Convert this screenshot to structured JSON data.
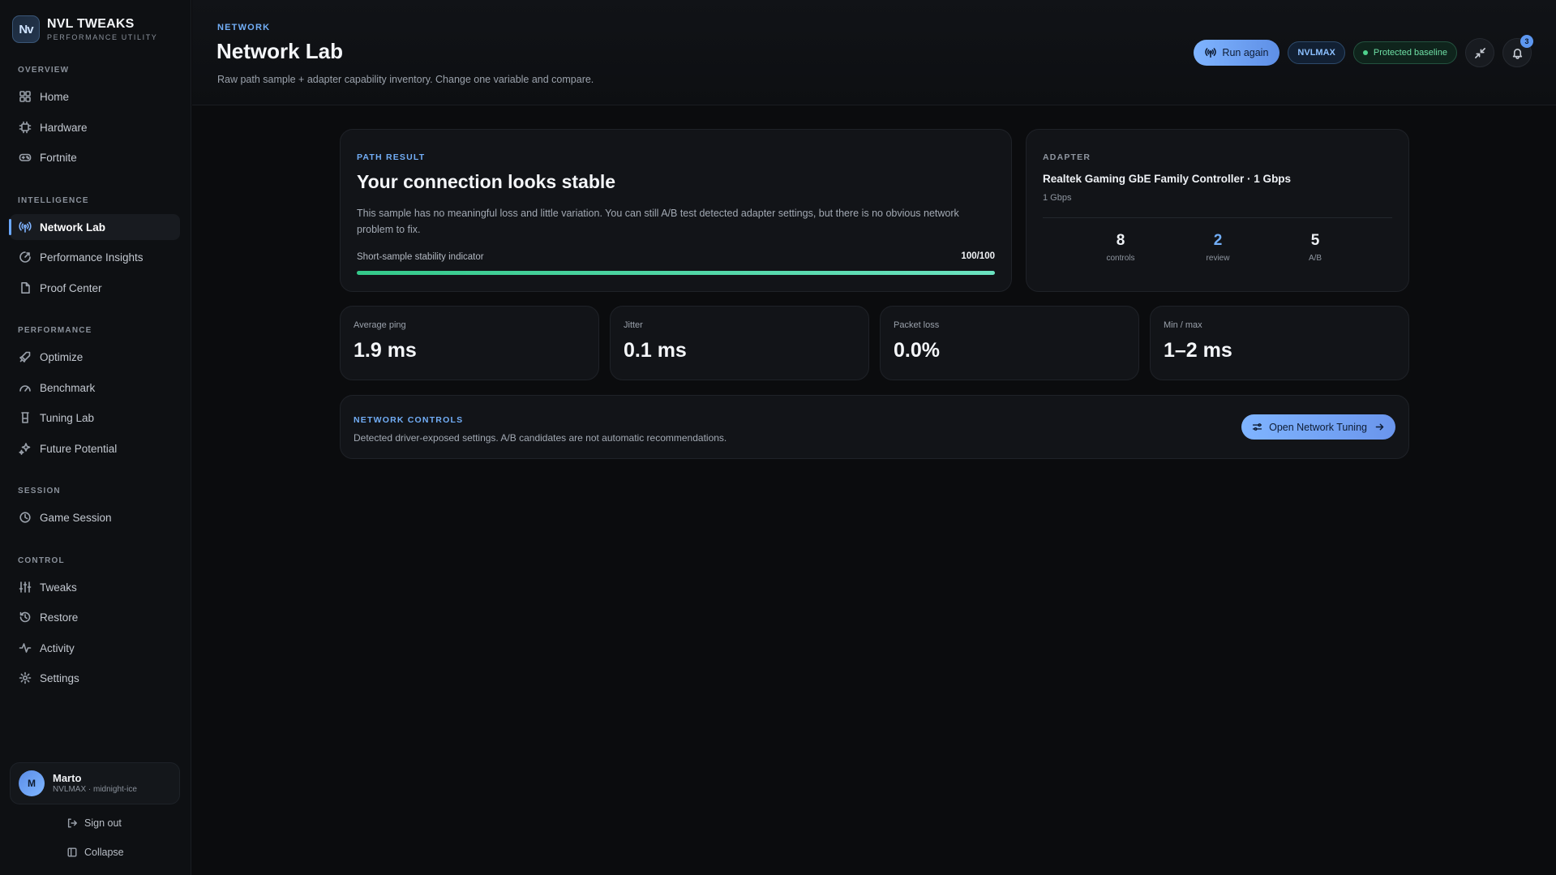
{
  "brand": {
    "logo": "Nv",
    "title": "NVL TWEAKS",
    "subtitle": "PERFORMANCE UTILITY"
  },
  "sidebar": {
    "sections": [
      {
        "title": "OVERVIEW",
        "items": [
          {
            "label": "Home",
            "icon": "home-icon"
          },
          {
            "label": "Hardware",
            "icon": "chip-icon"
          },
          {
            "label": "Fortnite",
            "icon": "gamepad-icon"
          }
        ]
      },
      {
        "title": "INTELLIGENCE",
        "items": [
          {
            "label": "Network Lab",
            "icon": "signal-icon",
            "active": true
          },
          {
            "label": "Performance Insights",
            "icon": "insights-icon"
          },
          {
            "label": "Proof Center",
            "icon": "document-icon"
          }
        ]
      },
      {
        "title": "PERFORMANCE",
        "items": [
          {
            "label": "Optimize",
            "icon": "rocket-icon"
          },
          {
            "label": "Benchmark",
            "icon": "gauge-icon"
          },
          {
            "label": "Tuning Lab",
            "icon": "flask-icon"
          },
          {
            "label": "Future Potential",
            "icon": "sparkles-icon"
          }
        ]
      },
      {
        "title": "SESSION",
        "items": [
          {
            "label": "Game Session",
            "icon": "session-icon"
          }
        ]
      },
      {
        "title": "CONTROL",
        "items": [
          {
            "label": "Tweaks",
            "icon": "sliders-icon"
          },
          {
            "label": "Restore",
            "icon": "restore-icon"
          },
          {
            "label": "Activity",
            "icon": "activity-icon"
          },
          {
            "label": "Settings",
            "icon": "gear-icon"
          }
        ]
      }
    ],
    "user": {
      "initial": "M",
      "name": "Marto",
      "subtitle": "NVLMAX · midnight-ice"
    },
    "sign_out": "Sign out",
    "collapse": "Collapse"
  },
  "header": {
    "eyebrow": "NETWORK",
    "title": "Network Lab",
    "subtitle": "Raw path sample + adapter capability inventory. Change one variable and compare.",
    "run_again": "Run again",
    "profile_pill": "NVLMAX",
    "baseline_pill": "Protected baseline",
    "notification_count": "3"
  },
  "path_result": {
    "label": "PATH RESULT",
    "headline": "Your connection looks stable",
    "body": "This sample has no meaningful loss and little variation. You can still A/B test detected adapter settings, but there is no obvious network problem to fix.",
    "stability_label": "Short-sample stability indicator",
    "stability_score": "100/100",
    "stability_fraction": 1.0
  },
  "adapter": {
    "label": "ADAPTER",
    "name": "Realtek Gaming GbE Family Controller · 1 Gbps",
    "speed": "1 Gbps",
    "stats": [
      {
        "value": "8",
        "label": "controls"
      },
      {
        "value": "2",
        "label": "review"
      },
      {
        "value": "5",
        "label": "A/B"
      }
    ]
  },
  "metrics": [
    {
      "label": "Average ping",
      "value": "1.9 ms"
    },
    {
      "label": "Jitter",
      "value": "0.1 ms"
    },
    {
      "label": "Packet loss",
      "value": "0.0%"
    },
    {
      "label": "Min / max",
      "value": "1–2 ms"
    }
  ],
  "network_controls": {
    "label": "NETWORK CONTROLS",
    "description": "Detected driver-exposed settings. A/B candidates are not automatic recommendations.",
    "button": "Open Network Tuning"
  },
  "colors": {
    "accent": "#72aef7",
    "success": "#4fd18d",
    "background": "#0b0c0e"
  }
}
